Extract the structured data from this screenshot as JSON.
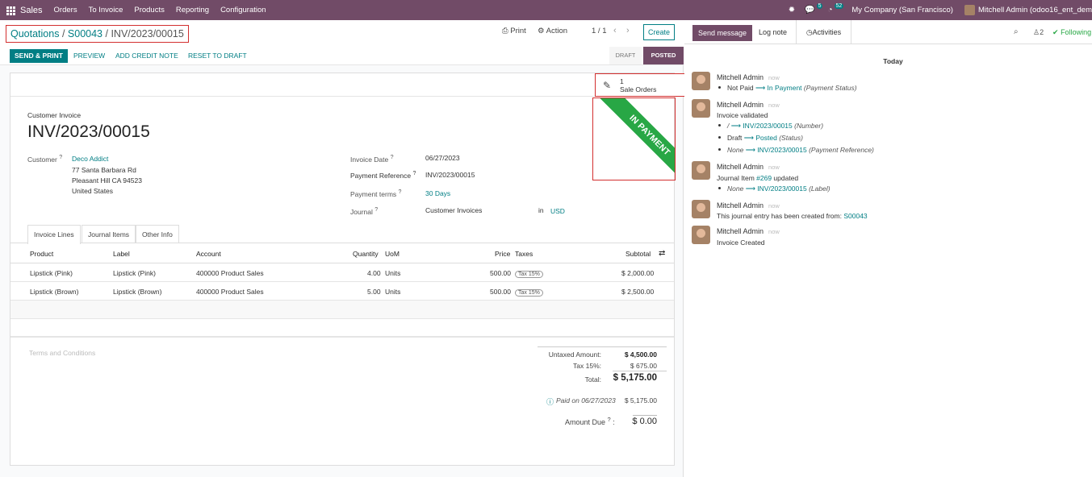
{
  "nav": {
    "app_name": "Sales",
    "menus": [
      "Orders",
      "To Invoice",
      "Products",
      "Reporting",
      "Configuration"
    ],
    "activity_count": "5",
    "message_count": "52",
    "company": "My Company (San Francisco)",
    "user": "Mitchell Admin (odoo16_ent_dem"
  },
  "breadcrumb": {
    "root": "Quotations",
    "order": "S00043",
    "current": "INV/2023/00015"
  },
  "control": {
    "print_label": "Print",
    "action_label": "Action",
    "pager": "1 / 1",
    "create_label": "Create"
  },
  "statusbar": {
    "send_print": "SEND & PRINT",
    "preview": "PREVIEW",
    "add_credit_note": "ADD CREDIT NOTE",
    "reset_to_draft": "RESET TO DRAFT",
    "stage_draft": "DRAFT",
    "stage_posted": "POSTED"
  },
  "smart_button": {
    "count": "1",
    "label": "Sale Orders"
  },
  "ribbon": "IN PAYMENT",
  "invoice": {
    "type_label": "Customer Invoice",
    "number": "INV/2023/00015",
    "customer_label": "Customer",
    "customer_name": "Deco Addict",
    "address_1": "77 Santa Barbara Rd",
    "address_2": "Pleasant Hill CA 94523",
    "address_3": "United States",
    "invoice_date_label": "Invoice Date",
    "invoice_date": "06/27/2023",
    "payment_ref_label": "Payment Reference",
    "payment_ref": "INV/2023/00015",
    "payment_terms_label": "Payment terms",
    "payment_terms": "30 Days",
    "journal_label": "Journal",
    "journal": "Customer Invoices",
    "in_label": "in",
    "currency": "USD"
  },
  "tabs": [
    "Invoice Lines",
    "Journal Items",
    "Other Info"
  ],
  "table": {
    "headers": {
      "product": "Product",
      "label": "Label",
      "account": "Account",
      "quantity": "Quantity",
      "uom": "UoM",
      "price": "Price",
      "taxes": "Taxes",
      "subtotal": "Subtotal"
    },
    "rows": [
      {
        "product": "Lipstick (Pink)",
        "label": "Lipstick (Pink)",
        "account": "400000 Product Sales",
        "quantity": "4.00",
        "uom": "Units",
        "price": "500.00",
        "taxes": "Tax 15%",
        "subtotal": "$ 2,000.00"
      },
      {
        "product": "Lipstick (Brown)",
        "label": "Lipstick (Brown)",
        "account": "400000 Product Sales",
        "quantity": "5.00",
        "uom": "Units",
        "price": "500.00",
        "taxes": "Tax 15%",
        "subtotal": "$ 2,500.00"
      }
    ]
  },
  "terms_placeholder": "Terms and Conditions",
  "totals": {
    "untaxed_label": "Untaxed Amount:",
    "untaxed": "$ 4,500.00",
    "tax_label": "Tax 15%:",
    "tax": "$ 675.00",
    "total_label": "Total:",
    "total": "$ 5,175.00",
    "paid_label": "Paid on 06/27/2023",
    "paid": "$ 5,175.00",
    "due_label": "Amount Due",
    "due": "$ 0.00"
  },
  "chatter": {
    "send_message": "Send message",
    "log_note": "Log note",
    "activities": "Activities",
    "followers_count": "2",
    "following": "Following",
    "today": "Today",
    "messages": [
      {
        "author": "Mitchell Admin",
        "time": "now",
        "lines": [
          {
            "old": "Not Paid",
            "new": "In Payment",
            "field": "(Payment Status)"
          }
        ]
      },
      {
        "author": "Mitchell Admin",
        "time": "now",
        "body": "Invoice validated",
        "lines": [
          {
            "old": "/",
            "new": "INV/2023/00015",
            "field": "(Number)"
          },
          {
            "old": "Draft",
            "new": "Posted",
            "field": "(Status)"
          },
          {
            "old": "None",
            "new": "INV/2023/00015",
            "field": "(Payment Reference)"
          }
        ]
      },
      {
        "author": "Mitchell Admin",
        "time": "now",
        "body_prefix": "Journal Item ",
        "body_link": "#269",
        "body_suffix": " updated",
        "lines": [
          {
            "old": "None",
            "new": "INV/2023/00015",
            "field": "(Label)"
          }
        ]
      },
      {
        "author": "Mitchell Admin",
        "time": "now",
        "body_prefix": "This journal entry has been created from: ",
        "body_link": "S00043"
      },
      {
        "author": "Mitchell Admin",
        "time": "now",
        "body": "Invoice Created"
      }
    ]
  }
}
